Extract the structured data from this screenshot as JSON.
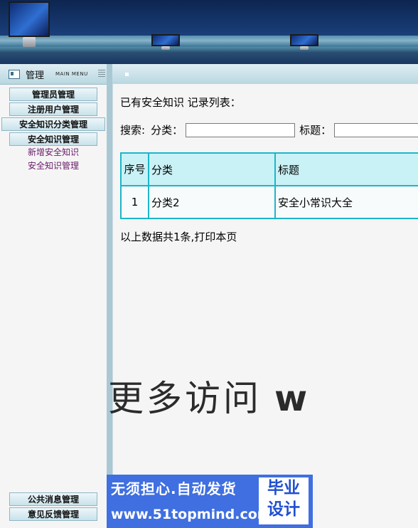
{
  "sidebar": {
    "header_title": "管理",
    "header_sub": "MAIN MENU",
    "menu": [
      {
        "label": "管理员管理"
      },
      {
        "label": "注册用户管理"
      },
      {
        "label": "安全知识分类管理"
      },
      {
        "label": "安全知识管理"
      }
    ],
    "submenu": [
      {
        "label": "新增安全知识"
      },
      {
        "label": "安全知识管理"
      }
    ],
    "bottom_menu": [
      {
        "label": "公共消息管理"
      },
      {
        "label": "意见反馈管理"
      }
    ]
  },
  "main": {
    "list_title": "已有安全知识  记录列表：",
    "search_label": "搜索:",
    "category_label": "分类：",
    "category_value": "",
    "title_label": "标题：",
    "title_value": "",
    "table": {
      "headers": [
        "序号",
        "分类",
        "标题"
      ],
      "rows": [
        [
          "1",
          "分类2",
          "安全小常识大全"
        ]
      ]
    },
    "summary_prefix": "以上数据共1条,",
    "print_link": "打印本页"
  },
  "watermark": {
    "text": "更多访问",
    "latin": "w"
  },
  "ad": {
    "line1": "无须担心.自动发货",
    "line2": "www.51topmind.com",
    "badge_line1": "毕业",
    "badge_line2": "设计"
  },
  "colors": {
    "accent": "#1bb6c9",
    "header_row": "#c9f2f6",
    "sidebar_bg": "#f5f5f5",
    "submenu_text": "#6a1a6a",
    "ad_bg": "#3f6fe0"
  }
}
